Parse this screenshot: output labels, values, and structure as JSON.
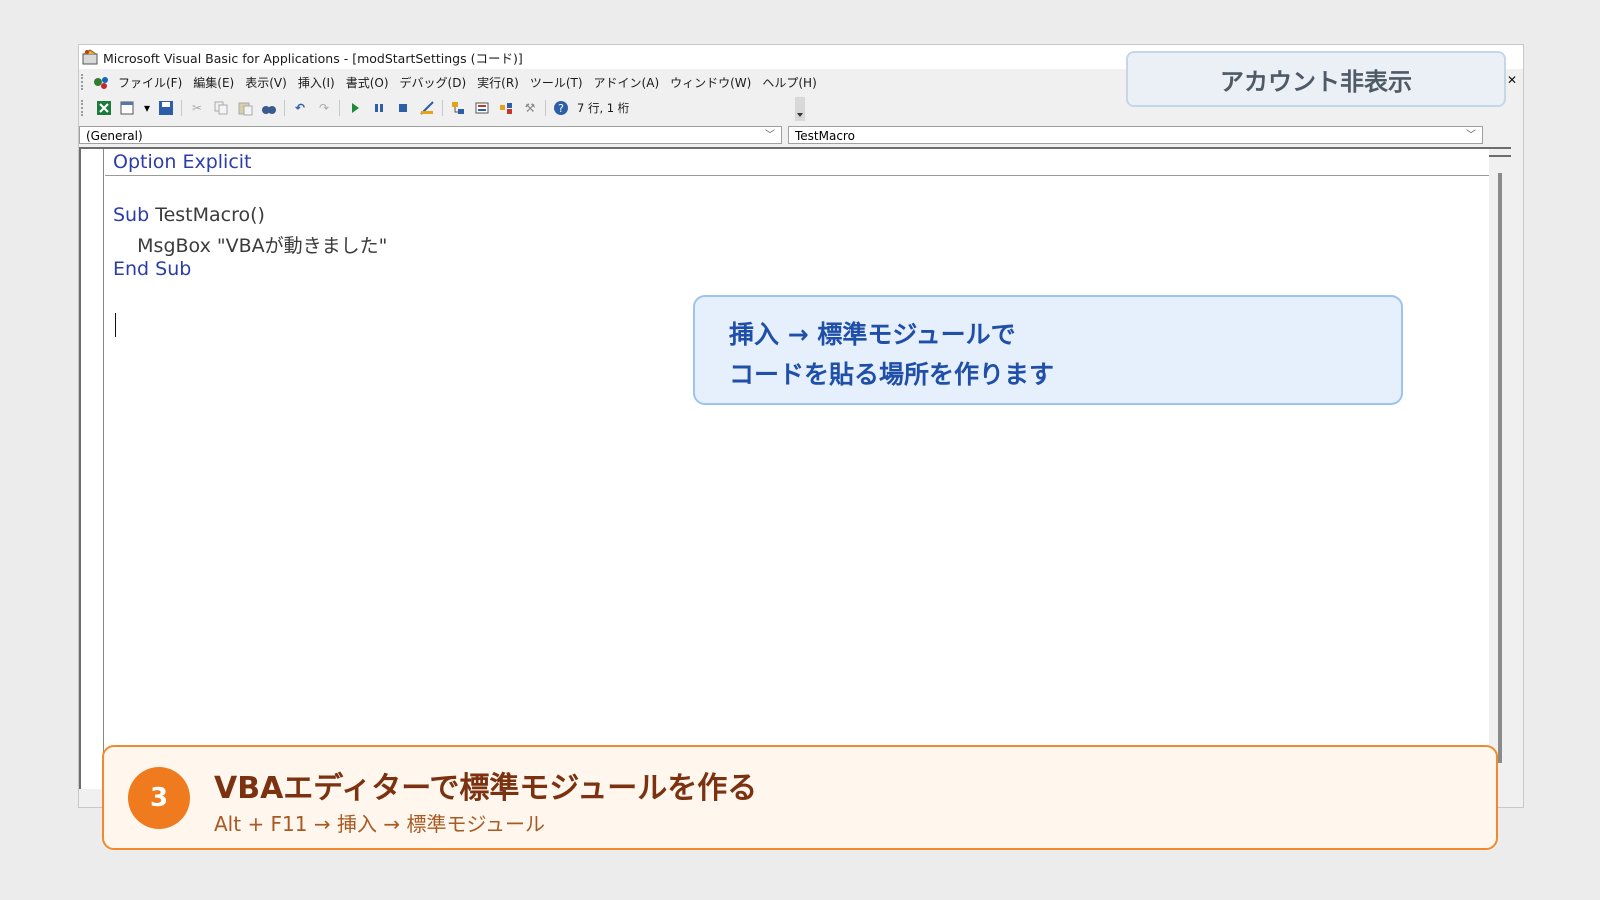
{
  "window": {
    "title": "Microsoft Visual Basic for Applications - [modStartSettings (コード)]"
  },
  "menu": {
    "items": [
      {
        "label": "ファイル(F)"
      },
      {
        "label": "編集(E)"
      },
      {
        "label": "表示(V)"
      },
      {
        "label": "挿入(I)"
      },
      {
        "label": "書式(O)"
      },
      {
        "label": "デバッグ(D)"
      },
      {
        "label": "実行(R)"
      },
      {
        "label": "ツール(T)"
      },
      {
        "label": "アドイン(A)"
      },
      {
        "label": "ウィンドウ(W)"
      },
      {
        "label": "ヘルプ(H)"
      }
    ]
  },
  "toolbar": {
    "cursor_position": "7 行, 1 桁",
    "icons": [
      "excel-icon",
      "insert-userform-icon",
      "save-icon",
      "cut-icon",
      "copy-icon",
      "paste-icon",
      "find-icon",
      "undo-icon",
      "redo-icon",
      "run-icon",
      "break-icon",
      "reset-icon",
      "design-mode-icon",
      "project-explorer-icon",
      "properties-icon",
      "object-browser-icon",
      "toolbox-icon",
      "help-icon"
    ]
  },
  "combos": {
    "object": "(General)",
    "procedure": "TestMacro"
  },
  "code": {
    "line1_keyword": "Option Explicit",
    "line2_keyword": "Sub",
    "line2_rest": " TestMacro()",
    "line3": "    MsgBox \"VBAが動きました\"",
    "line4_keyword": "End Sub"
  },
  "overlay": {
    "account_badge": "アカウント非表示",
    "callout_line1": "挿入 → 標準モジュールで",
    "callout_line2": "コードを貼る場所を作ります",
    "step_number": "3",
    "step_title": "VBAエディターで標準モジュールを作る",
    "step_subtitle": "Alt + F11 → 挿入 → 標準モジュール"
  },
  "colors": {
    "keyword": "#2b3da8",
    "callout_text": "#1f4fa8",
    "step_accent": "#f07a1e"
  }
}
